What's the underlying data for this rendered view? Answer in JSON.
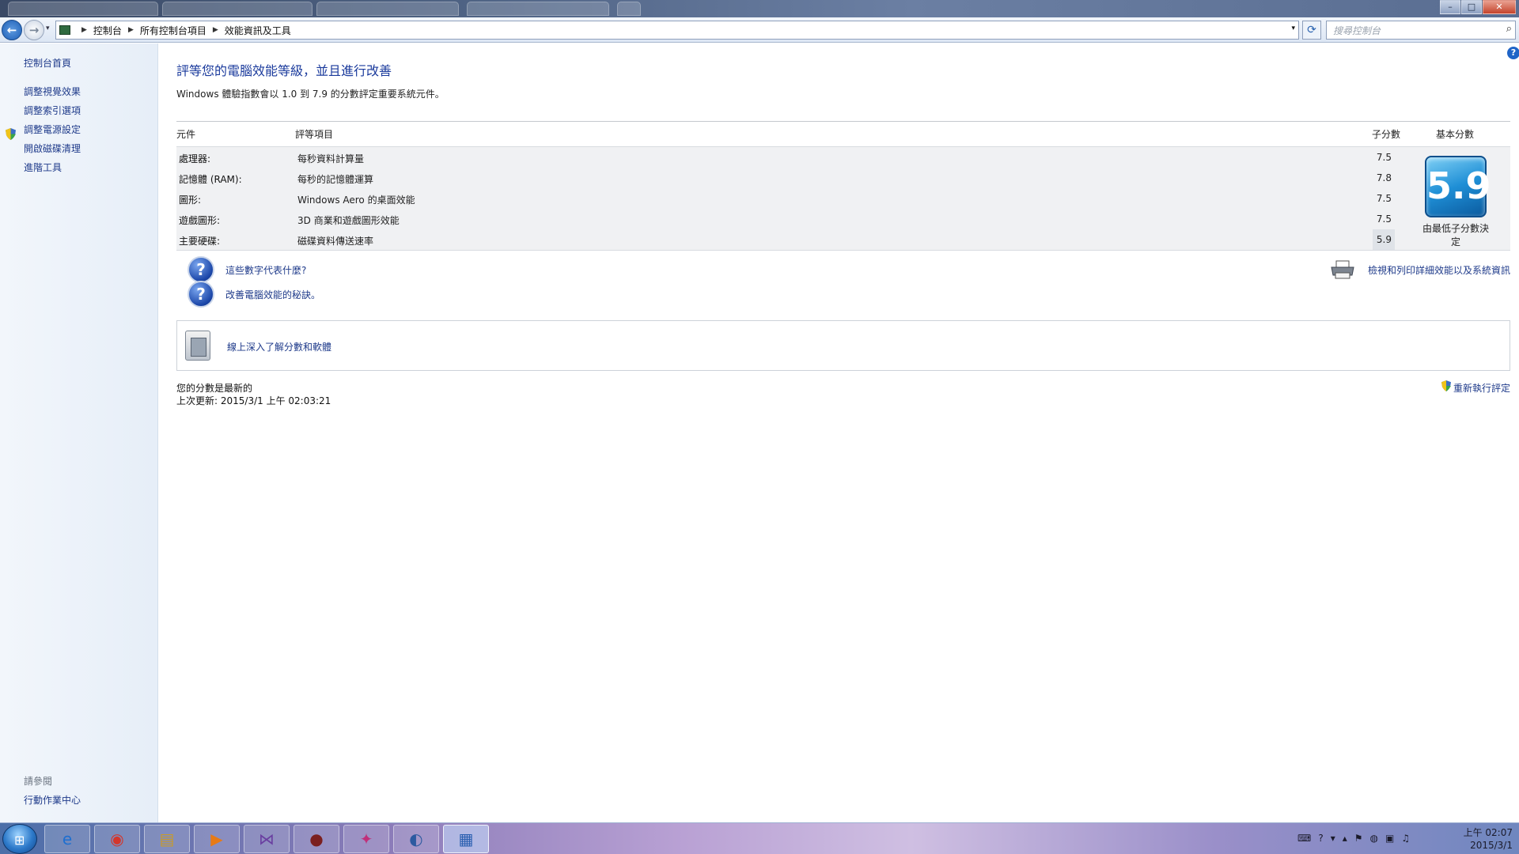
{
  "window": {
    "minimize": "–",
    "maximize": "□",
    "close": "✕"
  },
  "nav": {
    "back_icon": "←",
    "forward_icon": "→",
    "dropdown_icon": "▾",
    "refresh_icon": "⟳",
    "breadcrumbs": [
      "控制台",
      "所有控制台項目",
      "效能資訊及工具"
    ],
    "search_placeholder": "搜尋控制台"
  },
  "sidebar": {
    "home": "控制台首頁",
    "items": [
      {
        "label": "調整視覺效果"
      },
      {
        "label": "調整索引選項"
      },
      {
        "label": "調整電源設定"
      },
      {
        "label": "開啟磁碟清理"
      },
      {
        "label": "進階工具"
      }
    ],
    "see_also": "請參閱",
    "see_also_items": [
      {
        "label": "行動作業中心"
      }
    ]
  },
  "main": {
    "title": "評等您的電腦效能等級，並且進行改善",
    "subtitle": "Windows 體驗指數會以 1.0 到 7.9 的分數評定重要系統元件。",
    "columns": {
      "component": "元件",
      "rated": "評等項目",
      "subscore": "子分數",
      "basescore": "基本分數"
    },
    "rows": [
      {
        "component": "處理器:",
        "item": "每秒資料計算量",
        "score": "7.5"
      },
      {
        "component": "記憶體 (RAM):",
        "item": "每秒的記憶體運算",
        "score": "7.8"
      },
      {
        "component": "圖形:",
        "item": "Windows Aero 的桌面效能",
        "score": "7.5"
      },
      {
        "component": "遊戲圖形:",
        "item": "3D 商業和遊戲圖形效能",
        "score": "7.5"
      },
      {
        "component": "主要硬碟:",
        "item": "磁碟資料傳送速率",
        "score": "5.9"
      }
    ],
    "base_score": "5.9",
    "base_caption": "由最低子分數決定",
    "help_links": [
      {
        "label": "這些數字代表什麼?"
      },
      {
        "label": "改善電腦效能的秘訣。"
      }
    ],
    "print_link": "檢視和列印詳細效能以及系統資訊",
    "learn_link": "線上深入了解分數和軟體",
    "status_line1": "您的分數是最新的",
    "status_line2": "上次更新: 2015/3/1 上午 02:03:21",
    "rerun": "重新執行評定"
  },
  "taskbar": {
    "apps": [
      {
        "name": "internet-explorer",
        "glyph": "e"
      },
      {
        "name": "chrome",
        "glyph": "◉"
      },
      {
        "name": "file-explorer",
        "glyph": "▤"
      },
      {
        "name": "media-player",
        "glyph": "▶"
      },
      {
        "name": "visual-studio",
        "glyph": "⋈"
      },
      {
        "name": "app-6",
        "glyph": "●"
      },
      {
        "name": "app-7",
        "glyph": "✦"
      },
      {
        "name": "app-8",
        "glyph": "◐"
      },
      {
        "name": "control-panel",
        "glyph": "▦"
      }
    ],
    "clock_time": "上午 02:07",
    "clock_date": "2015/3/1"
  }
}
